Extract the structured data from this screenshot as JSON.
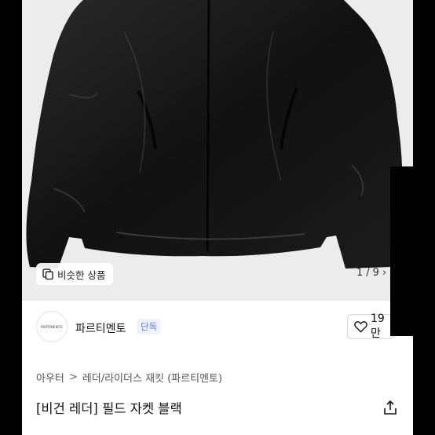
{
  "image_overlay": {
    "similar_label": "비슷한 상품",
    "page_current": "1",
    "page_separator": "/",
    "page_total": "9",
    "next_glyph": "›"
  },
  "brand": {
    "logo_text": "PARTIMENTO",
    "name": "파르티멘토",
    "badge": "단독",
    "likes": "19만"
  },
  "breadcrumb": {
    "items": [
      "아우터",
      "레더/라이더스 재킷 (파르티멘토)"
    ]
  },
  "product": {
    "title": "[비건 레더] 필드 자켓 블랙"
  },
  "icons": {
    "similar": "similar-products-icon",
    "heart": "heart-icon",
    "share": "share-icon",
    "chevron": "chevron-right-icon"
  }
}
